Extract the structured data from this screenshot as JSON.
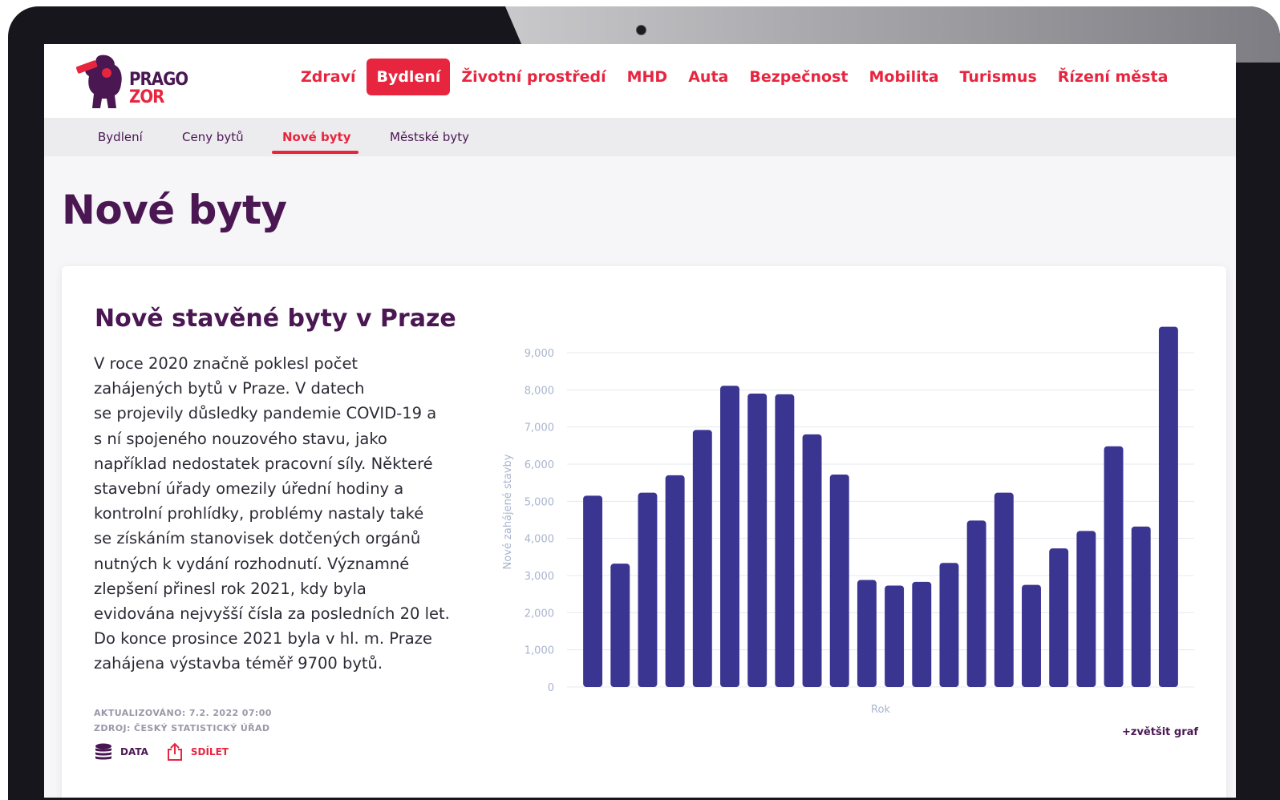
{
  "logo": {
    "line1": "PRAGO",
    "line2": "ZOR"
  },
  "nav": {
    "items": [
      {
        "label": "Zdraví",
        "active": false
      },
      {
        "label": "Bydlení",
        "active": true
      },
      {
        "label": "Životní prostředí",
        "active": false
      },
      {
        "label": "MHD",
        "active": false
      },
      {
        "label": "Auta",
        "active": false
      },
      {
        "label": "Bezpečnost",
        "active": false
      },
      {
        "label": "Mobilita",
        "active": false
      },
      {
        "label": "Turismus",
        "active": false
      },
      {
        "label": "Řízení města",
        "active": false
      }
    ]
  },
  "subnav": {
    "items": [
      {
        "label": "Bydlení",
        "active": false
      },
      {
        "label": "Ceny bytů",
        "active": false
      },
      {
        "label": "Nové byty",
        "active": true
      },
      {
        "label": "Městské byty",
        "active": false
      }
    ]
  },
  "page": {
    "title": "Nové byty"
  },
  "card": {
    "title": "Nově stavěné byty v Praze",
    "text_lines": [
      "V roce 2020 značně poklesl počet",
      "zahájených bytů v Praze. V datech",
      "se projevily důsledky pandemie COVID-19 a",
      "s ní spojeného nouzového stavu, jako",
      "například nedostatek pracovní síly. Některé",
      "stavební úřady omezily úřední hodiny a",
      "kontrolní prohlídky, problémy nastaly také",
      "se získáním stanovisek dotčených orgánů",
      "nutných k vydání rozhodnutí. Významné",
      "zlepšení přinesl rok 2021, kdy byla",
      "evidována nejvyšší čísla za posledních 20 let.",
      "Do konce prosince 2021 byla v hl. m. Praze",
      "zahájena výstavba téměř 9700 bytů."
    ],
    "updated": "AKTUALIZOVÁNO: 7.2. 2022 07:00",
    "source": "ZDROJ: ČESKÝ STATISTICKÝ ÚŘAD",
    "data_label": "DATA",
    "share_label": "SDÍLET",
    "enlarge_label": "+zvětšit graf"
  },
  "colors": {
    "accent": "#e8253f",
    "brand": "#4a1753",
    "bar": "#3b3592",
    "axis": "#a8b4ce",
    "grid": "#e6e8f0"
  },
  "chart_data": {
    "type": "bar",
    "xlabel": "Rok",
    "ylabel": "Nové zahájené stavby",
    "ylim": [
      0,
      9000
    ],
    "yticks": [
      0,
      1000,
      2000,
      3000,
      4000,
      5000,
      6000,
      7000,
      8000,
      9000
    ],
    "ytick_labels": [
      "0",
      "1,000",
      "2,000",
      "3,000",
      "4,000",
      "5,000",
      "6,000",
      "7,000",
      "8,000",
      "9,000"
    ],
    "grid": true,
    "values": [
      5150,
      3320,
      5230,
      5700,
      6920,
      8110,
      7900,
      7880,
      6800,
      5720,
      2880,
      2730,
      2830,
      3340,
      4480,
      5230,
      2750,
      3730,
      4200,
      6480,
      4320,
      9700
    ]
  }
}
